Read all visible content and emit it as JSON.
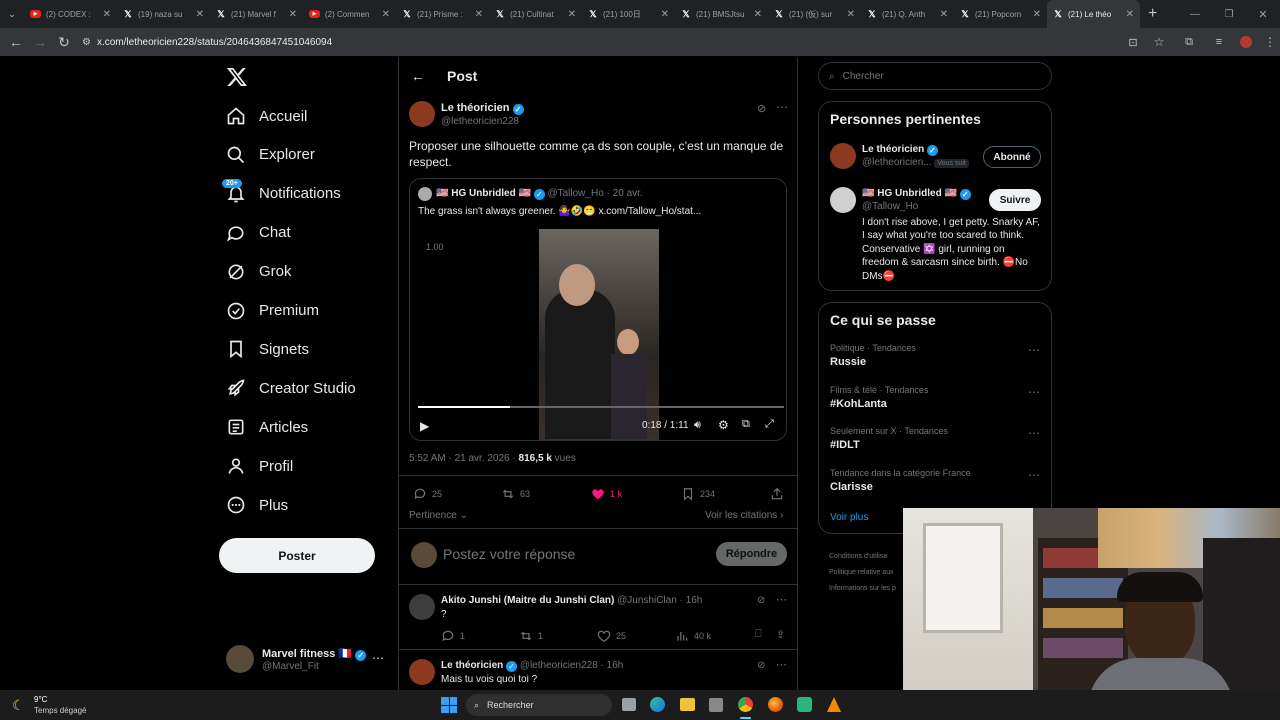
{
  "browser": {
    "tabs": [
      {
        "icon": "youtube-icon",
        "label": "(2) CODEX :"
      },
      {
        "icon": "x-icon",
        "label": "(19) naza su"
      },
      {
        "icon": "x-icon",
        "label": "(21) Marvel f"
      },
      {
        "icon": "youtube-icon",
        "label": "(2) Commen"
      },
      {
        "icon": "x-icon",
        "label": "(21) Prisme :"
      },
      {
        "icon": "x-icon",
        "label": "(21) Cultinat"
      },
      {
        "icon": "x-icon",
        "label": "(21) 100日"
      },
      {
        "icon": "x-icon",
        "label": "(21) BMSJtsu"
      },
      {
        "icon": "x-icon",
        "label": "(21) (仮) sur"
      },
      {
        "icon": "x-icon",
        "label": "(21) Q. Anth"
      },
      {
        "icon": "x-icon",
        "label": "(21) Popcorn"
      },
      {
        "icon": "x-icon",
        "label": "(21) Le théo"
      }
    ],
    "url": "x.com/letheoricien228/status/2046436847451046094"
  },
  "sidebar": {
    "items": [
      {
        "label": "Accueil",
        "icon": "home-icon"
      },
      {
        "label": "Explorer",
        "icon": "search-icon"
      },
      {
        "label": "Notifications",
        "icon": "bell-icon",
        "badge": "20+"
      },
      {
        "label": "Chat",
        "icon": "chat-icon"
      },
      {
        "label": "Grok",
        "icon": "grok-icon"
      },
      {
        "label": "Premium",
        "icon": "premium-icon"
      },
      {
        "label": "Signets",
        "icon": "bookmark-icon"
      },
      {
        "label": "Creator Studio",
        "icon": "rocket-icon"
      },
      {
        "label": "Articles",
        "icon": "article-icon"
      },
      {
        "label": "Profil",
        "icon": "person-icon"
      },
      {
        "label": "Plus",
        "icon": "more-circle-icon"
      }
    ],
    "post_button": "Poster",
    "account": {
      "name": "Marvel fitness 🇫🇷",
      "handle": "@Marvel_Fit"
    }
  },
  "post": {
    "header_title": "Post",
    "author": {
      "name": "Le théoricien",
      "handle": "@letheoricien228"
    },
    "text": "Proposer une silhouette comme ça ds son couple, c’est un manque de respect.",
    "quote": {
      "name": "🇺🇸 HG Unbridled 🇺🇸",
      "handle": "@Tallow_Ho",
      "date": "20 avr.",
      "text": "The grass isn't always greener. 🤷‍♀️🤣😁 x.com/Tallow_Ho/stat...",
      "video": {
        "speed": "1.00",
        "time": "0:18 / 1:11",
        "progress": 0.25
      }
    },
    "meta": {
      "time": "5:52 AM · 21 avr. 2026 ·",
      "views": "816,5 k",
      "views_label": "vues"
    },
    "stats": {
      "replies": "25",
      "reposts": "63",
      "likes": "1 k",
      "bookmarks": "234"
    },
    "sort_label": "Pertinence",
    "quotes_link": "Voir les citations",
    "reply_placeholder": "Postez votre réponse",
    "reply_button": "Répondre"
  },
  "replies": [
    {
      "name": "Akito Junshi (Maitre du Junshi Clan)",
      "handle": "@JunshiClan",
      "time": "· 16h",
      "text": "?",
      "stats": {
        "replies": "1",
        "reposts": "1",
        "likes": "25",
        "views": "40 k"
      }
    },
    {
      "name": "Le théoricien",
      "handle": "@letheoricien228",
      "time": "· 16h",
      "text": "Mais tu vois quoi toi ?"
    }
  ],
  "right": {
    "search_placeholder": "Chercher",
    "relevant_title": "Personnes pertinentes",
    "people": [
      {
        "name": "Le théoricien",
        "handle": "@letheoricien...",
        "follows_you": "Vous suit",
        "button": "Abonné"
      },
      {
        "name": "🇺🇸 HG Unbridled 🇺🇸",
        "handle": "@Tallow_Ho",
        "button": "Suivre",
        "bio": "I don't rise above, I get petty. Snarky AF, I say what you're too scared to think. Conservative ✡️ girl, running on freedom & sarcasm since birth. ⛔No DMs⛔"
      }
    ],
    "trends_title": "Ce qui se passe",
    "trends": [
      {
        "category": "Politique · Tendances",
        "name": "Russie"
      },
      {
        "category": "Films & télé · Tendances",
        "name": "#KohLanta"
      },
      {
        "category": "Seulement sur X · Tendances",
        "name": "#IDLT"
      },
      {
        "category": "Tendance dans la catégorie France",
        "name": "Clarisse"
      }
    ],
    "show_more": "Voir plus",
    "footer": [
      "Conditions d'utilisa",
      "Politique relative aux",
      "Informations sur les p"
    ]
  },
  "taskbar": {
    "weather_temp": "9°C",
    "weather_desc": "Temps dégagé",
    "search_placeholder": "Rechercher"
  },
  "colors": {
    "accent": "#1d9bf0",
    "like": "#f91880",
    "background": "#000000"
  }
}
